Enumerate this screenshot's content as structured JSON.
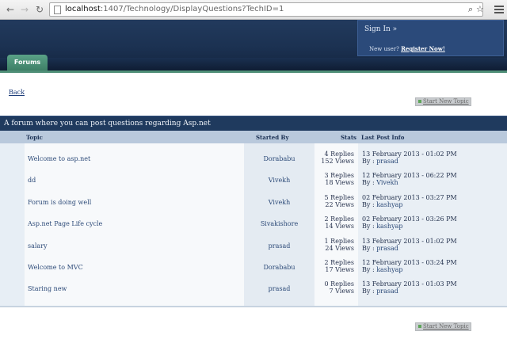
{
  "browser": {
    "back_glyph": "←",
    "forward_glyph": "→",
    "reload_glyph": "↻",
    "url_host": "localhost",
    "url_path": ":1407/Technology/DisplayQuestions?TechID=1"
  },
  "header": {
    "signin_label": "Sign In »",
    "new_user_label": "New user?",
    "register_label": "Register Now!",
    "forums_tab_label": "Forums"
  },
  "back_label": "Back",
  "start_topic_label": "Start New Topic",
  "forum": {
    "title": "A forum where you can post questions regarding Asp.net",
    "columns": {
      "topic": "Topic",
      "started_by": "Started By",
      "stats": "Stats",
      "last_post": "Last Post Info"
    },
    "topics": [
      {
        "title": "Welcome to asp.net",
        "starter": "Dorababu",
        "replies": "4 Replies",
        "views": "152 Views",
        "last_date": "13 February 2013 - 01:02 PM",
        "last_by_prefix": "By :",
        "last_by": "prasad"
      },
      {
        "title": "dd",
        "starter": "Vivekh",
        "replies": "3 Replies",
        "views": "18 Views",
        "last_date": "12 February 2013 - 06:22 PM",
        "last_by_prefix": "By :",
        "last_by": "Vivekh"
      },
      {
        "title": "Forum is doing well",
        "starter": "Vivekh",
        "replies": "5 Replies",
        "views": "22 Views",
        "last_date": "02 February 2013 - 03:27 PM",
        "last_by_prefix": "By :",
        "last_by": "kashyap"
      },
      {
        "title": "Asp.net Page Life cycle",
        "starter": "Sivakishore",
        "replies": "2 Replies",
        "views": "14 Views",
        "last_date": "02 February 2013 - 03:26 PM",
        "last_by_prefix": "By :",
        "last_by": "kashyap"
      },
      {
        "title": "salary",
        "starter": "prasad",
        "replies": "1 Replies",
        "views": "24 Views",
        "last_date": "13 February 2013 - 01:02 PM",
        "last_by_prefix": "By :",
        "last_by": "prasad"
      },
      {
        "title": "Welcome to MVC",
        "starter": "Dorababu",
        "replies": "2 Replies",
        "views": "17 Views",
        "last_date": "12 February 2013 - 03:24 PM",
        "last_by_prefix": "By :",
        "last_by": "kashyap"
      },
      {
        "title": "Staring new",
        "starter": "prasad",
        "replies": "0 Replies",
        "views": "7 Views",
        "last_date": "13 February 2013 - 01:03 PM",
        "last_by_prefix": "By :",
        "last_by": "prasad"
      }
    ]
  },
  "colors": {
    "header_bg": "#1b3151",
    "title_bar": "#1f3a5e",
    "column_header": "#b9c9dc",
    "tab_green": "#4f8f77",
    "link": "#2c4a78"
  }
}
